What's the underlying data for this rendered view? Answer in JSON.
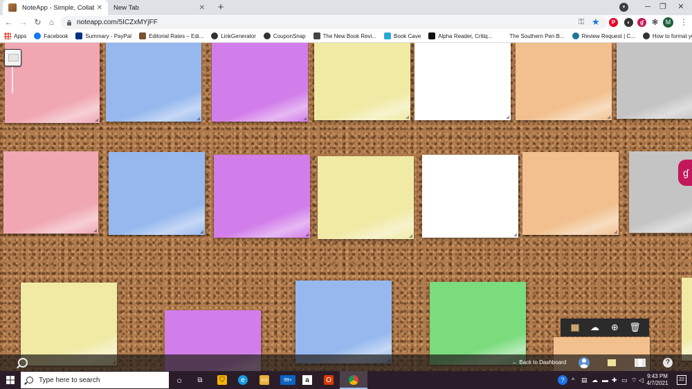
{
  "browser": {
    "tabs": [
      {
        "label": "NoteApp - Simple, Collaborative",
        "active": true
      },
      {
        "label": "New Tab",
        "active": false
      }
    ],
    "url": "noteapp.com/5ICZxMYjFF",
    "bookmarks": [
      {
        "label": "Apps",
        "color": "#e8453c"
      },
      {
        "label": "Facebook",
        "color": "#1877f2"
      },
      {
        "label": "Summary - PayPal",
        "color": "#003087"
      },
      {
        "label": "Editorial Rates – Edi...",
        "color": "#7a5230"
      },
      {
        "label": "LinkGenerator",
        "color": "#333333"
      },
      {
        "label": "CouponSnap",
        "color": "#333333"
      },
      {
        "label": "The New Book Revi...",
        "color": "#444444"
      },
      {
        "label": "Book Cave",
        "color": "#2aa8d6"
      },
      {
        "label": "Alpha Reader, Critiq...",
        "color": "#111111"
      },
      {
        "label": "The Southern Pen B...",
        "color": "#ffffff"
      },
      {
        "label": "Review Request | C...",
        "color": "#21759b"
      },
      {
        "label": "How to format your...",
        "color": "#333333"
      }
    ]
  },
  "board": {
    "notes": [
      {
        "color": "#f0a7b2"
      },
      {
        "color": "#96b8ee"
      },
      {
        "color": "#d27eea"
      },
      {
        "color": "#f0eaa4"
      },
      {
        "color": "#ffffff"
      },
      {
        "color": "#f2c08e"
      },
      {
        "color": "#c4c4c4"
      },
      {
        "color": "#f0a7b2"
      },
      {
        "color": "#96b8ee"
      },
      {
        "color": "#d27eea"
      },
      {
        "color": "#f0eaa4"
      },
      {
        "color": "#ffffff"
      },
      {
        "color": "#f2c08e"
      },
      {
        "color": "#c4c4c4"
      },
      {
        "color": "#f0eaa4"
      },
      {
        "color": "#d27eea"
      },
      {
        "color": "#96b8ee"
      },
      {
        "color": "#7bdc7e"
      },
      {
        "color": "#f0eaa4"
      },
      {
        "color": "#f2c08e"
      }
    ]
  },
  "app_bar": {
    "back_label": "← Back to Dashboard",
    "help_label": "?"
  },
  "taskbar": {
    "search_placeholder": "Type here to search",
    "mail_badge": "99+",
    "time": "9:43 PM",
    "date": "4/7/2021",
    "notifications": "22"
  }
}
